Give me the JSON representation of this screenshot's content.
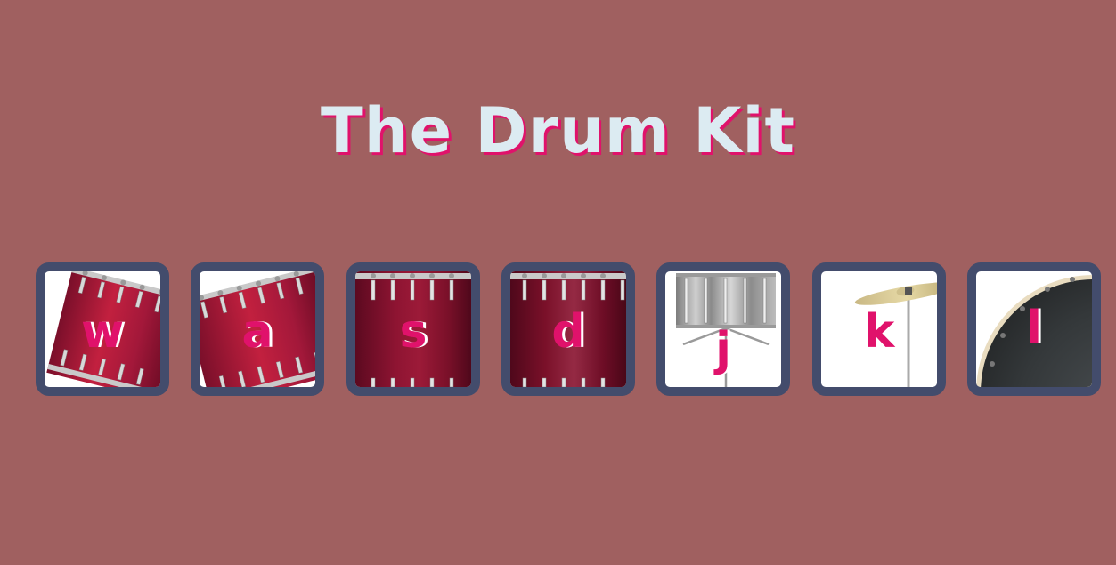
{
  "page": {
    "title": "The Drum Kit"
  },
  "drums": [
    {
      "key": "w",
      "icon": "tom1-icon"
    },
    {
      "key": "a",
      "icon": "tom2-icon"
    },
    {
      "key": "s",
      "icon": "tom3-icon"
    },
    {
      "key": "d",
      "icon": "tom4-icon"
    },
    {
      "key": "j",
      "icon": "snare-icon"
    },
    {
      "key": "k",
      "icon": "crash-cymbal-icon"
    },
    {
      "key": "l",
      "icon": "kick-drum-icon"
    }
  ],
  "colors": {
    "background": "#a06060",
    "title": "#dcebf2",
    "accent": "#e0126b",
    "tile_border": "#434c6c"
  }
}
